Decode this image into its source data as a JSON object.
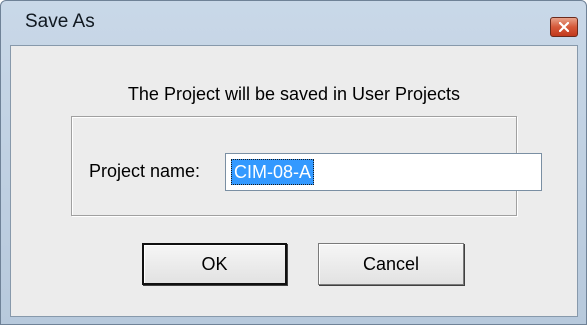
{
  "window": {
    "title": "Save As",
    "close_icon": "close-icon"
  },
  "dialog": {
    "message": "The Project will be saved in User Projects",
    "project_name_label": "Project name:",
    "project_name_value": "CIM-08-A",
    "ok_label": "OK",
    "cancel_label": "Cancel"
  },
  "colors": {
    "titlebar": "#c9d8e8",
    "client_background": "#ececec",
    "selection": "#3399ff",
    "close_button": "#d5593a"
  }
}
